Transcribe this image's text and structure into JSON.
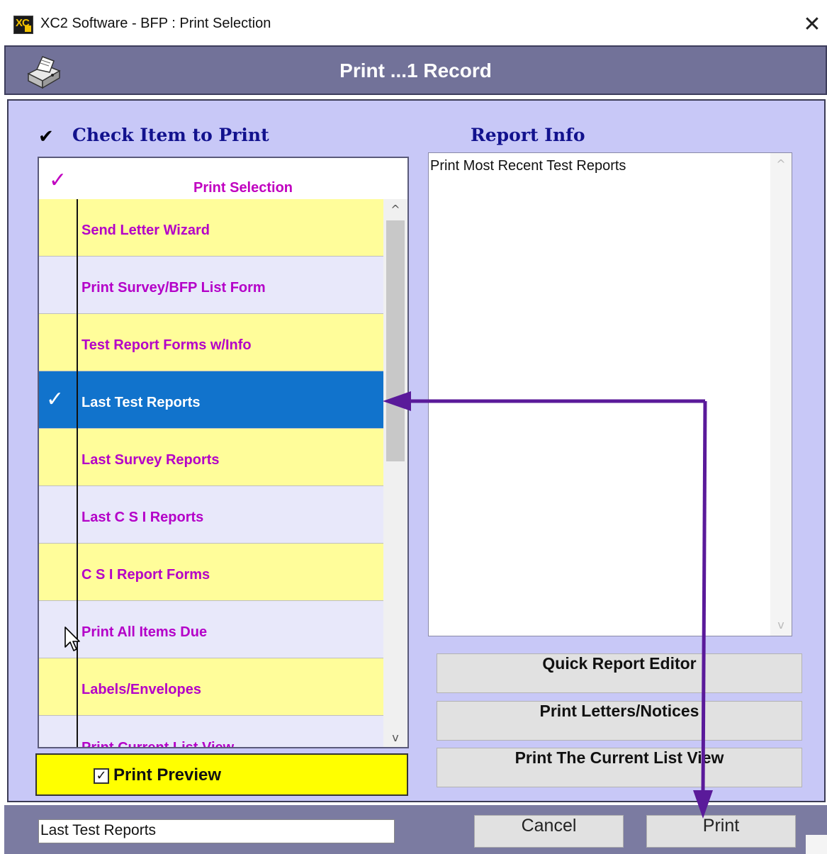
{
  "window": {
    "app_icon_text": "XC",
    "title": "XC2 Software - BFP : Print Selection",
    "close_glyph": "✕"
  },
  "header": {
    "title": "Print ...1 Record",
    "icon": "printer-icon"
  },
  "left_panel": {
    "heading_check": "✔",
    "heading": "Check Item to Print",
    "list_header_check": "✓",
    "list_header_title": "Print  Selection",
    "items": [
      {
        "label": "Send  Letter  Wizard",
        "checked": false,
        "check": "",
        "bg": "yellow"
      },
      {
        "label": "Print  Survey/BFP  List  Form",
        "checked": false,
        "check": "",
        "bg": "lavender"
      },
      {
        "label": "Test  Report  Forms  w/Info",
        "checked": false,
        "check": "",
        "bg": "yellow"
      },
      {
        "label": "Last  Test  Reports",
        "checked": true,
        "check": "✓",
        "bg": "selected"
      },
      {
        "label": "Last  Survey  Reports",
        "checked": false,
        "check": "",
        "bg": "yellow"
      },
      {
        "label": "Last  C S I  Reports",
        "checked": false,
        "check": "",
        "bg": "lavender"
      },
      {
        "label": "C S I  Report  Forms",
        "checked": false,
        "check": "",
        "bg": "yellow"
      },
      {
        "label": "Print  All  Items  Due",
        "checked": false,
        "check": "",
        "bg": "lavender"
      },
      {
        "label": "Labels/Envelopes",
        "checked": false,
        "check": "",
        "bg": "yellow"
      },
      {
        "label": "Print  Current  List  View",
        "checked": false,
        "check": "",
        "bg": "lavender"
      }
    ],
    "scroll_up": "^",
    "scroll_down": "v",
    "print_preview": {
      "label": "Print Preview",
      "checked": true,
      "check": "✓"
    }
  },
  "right_panel": {
    "heading": "Report Info",
    "info_text": "Print Most Recent Test Reports",
    "scroll_up": "^",
    "scroll_down": "v",
    "buttons": {
      "quick_report_editor": "Quick Report Editor",
      "print_letters": "Print Letters/Notices",
      "print_list_view": "Print The Current List View"
    }
  },
  "footer": {
    "selection_value": "Last Test Reports",
    "cancel_label": "Cancel",
    "print_label": "Print"
  },
  "colors": {
    "header_bg": "#727299",
    "panel_bg": "#c8c8f7",
    "heading_text": "#12128e",
    "item_text": "#b400c8",
    "row_yellow": "#fffd9a",
    "row_lavender": "#e8e8fa",
    "row_selected": "#1173cc",
    "preview_bg": "#ffff00",
    "annotation_arrow": "#5a1a9a"
  }
}
